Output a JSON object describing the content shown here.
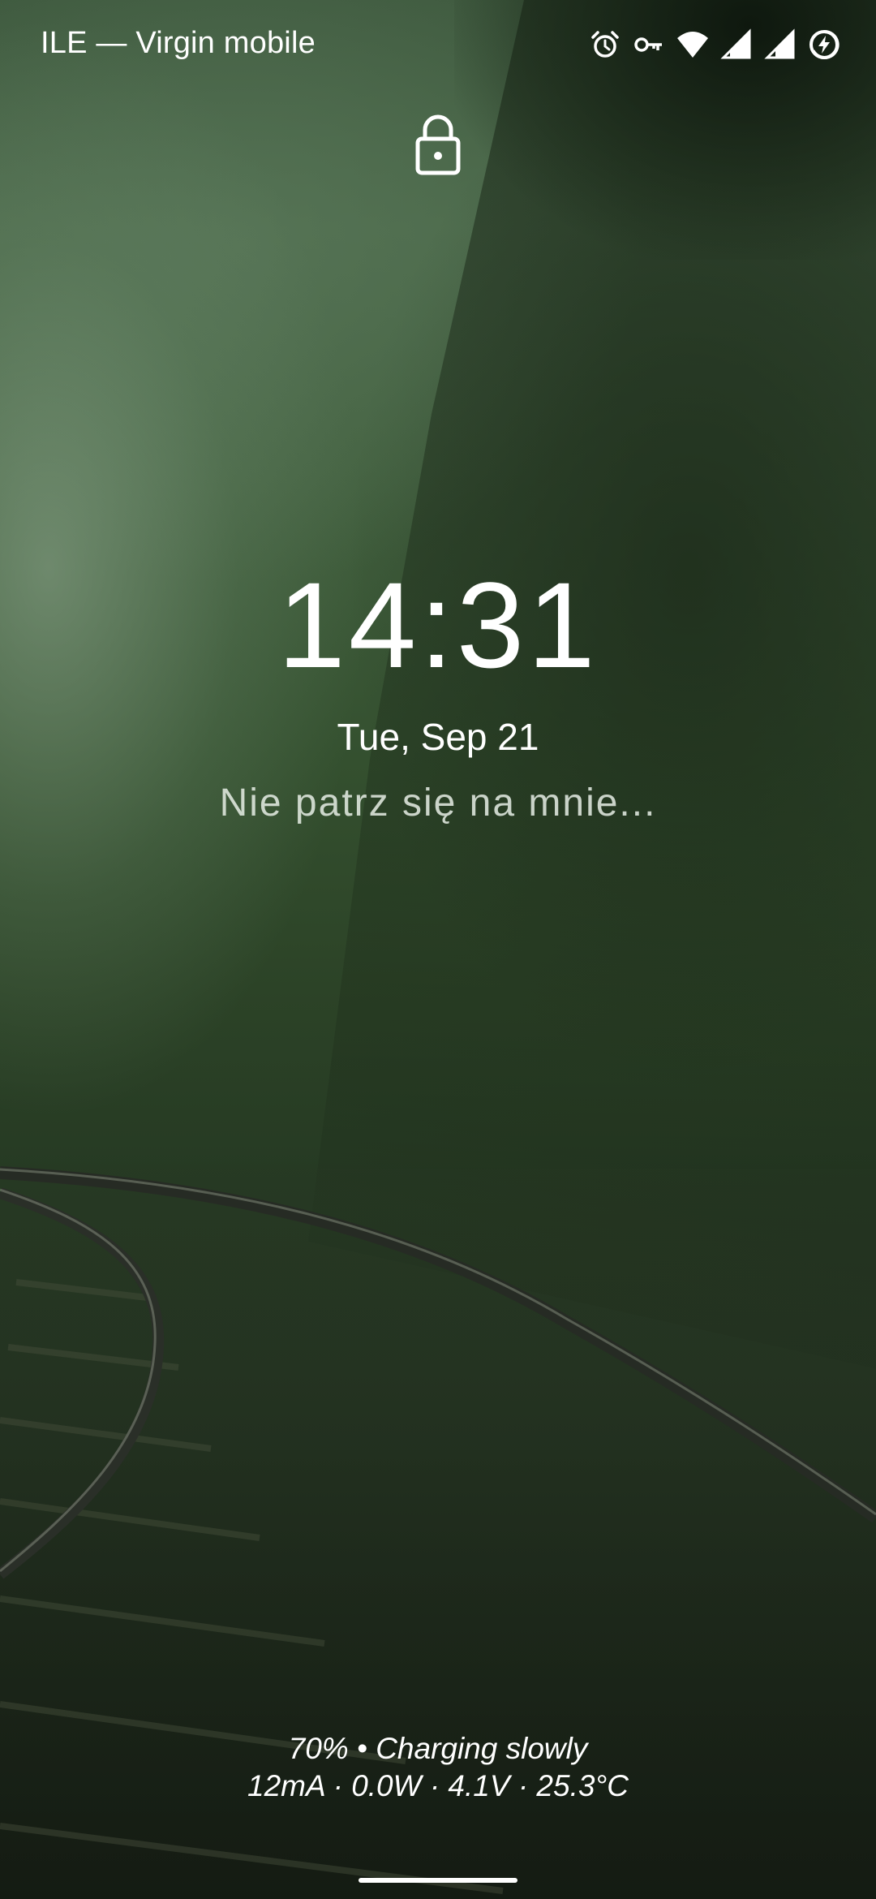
{
  "status_bar": {
    "carrier": "ILE — Virgin mobile",
    "icons": [
      "alarm-icon",
      "vpn-key-icon",
      "wifi-icon",
      "signal-icon",
      "signal-icon",
      "battery-charging-icon"
    ]
  },
  "lock_screen": {
    "lock_icon": "lock-icon",
    "time": "14:31",
    "date": "Tue, Sep 21",
    "owner_info": "Nie patrz się na mnie..."
  },
  "charging": {
    "status": "70% • Charging slowly",
    "details": "12mA · 0.0W · 4.1V · 25.3°C"
  },
  "colors": {
    "text": "#ffffff",
    "wallpaper_dark": "#1a2219",
    "wallpaper_mid": "#3f5a3f"
  }
}
